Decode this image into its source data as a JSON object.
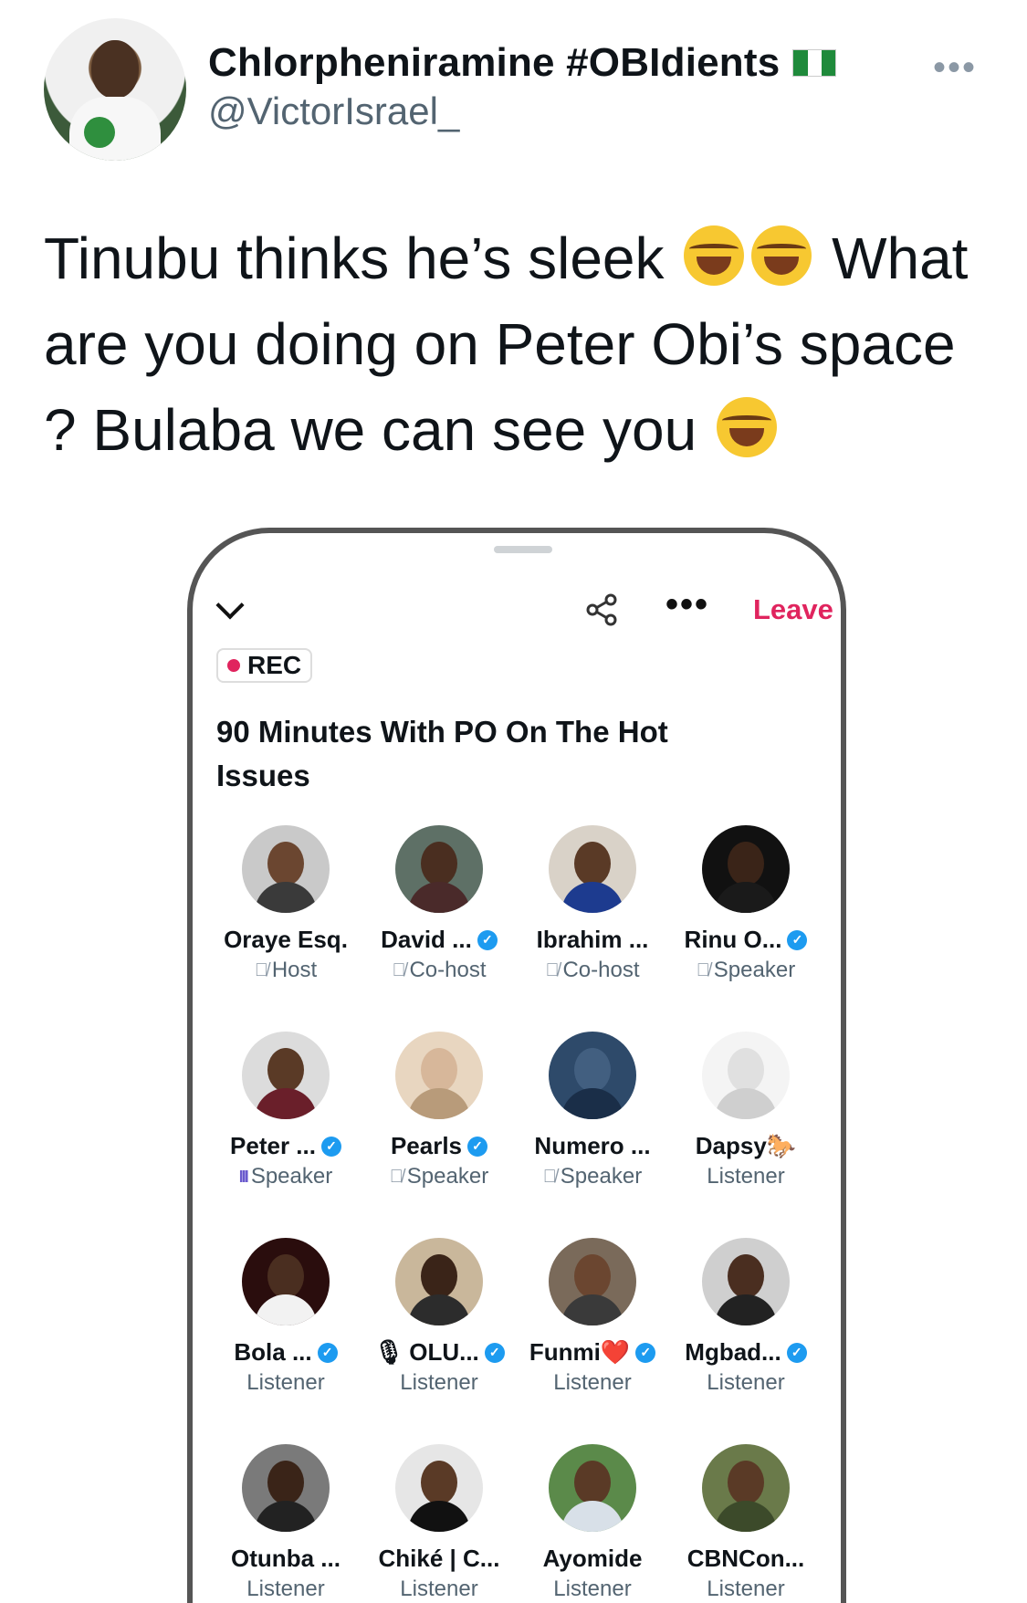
{
  "tweet": {
    "display_name": "Chlorpheniramine #OBIdients",
    "handle": "@VictorIsrael_",
    "more_label": "•••",
    "text_parts": [
      "Tinubu thinks he’s sleek",
      "What are you doing on Peter Obi’s space ? Bulaba we can see you"
    ]
  },
  "space": {
    "leave_label": "Leave",
    "more_label": "•••",
    "rec_label": "REC",
    "title": "90 Minutes With PO On The Hot Issues",
    "people": [
      {
        "name": "Oraye Esq.",
        "role": "Host",
        "mic": "off",
        "verified": false,
        "colors": [
          "#c9c9c9",
          "#6b4630",
          "#3a3a3a"
        ]
      },
      {
        "name": "David ...",
        "role": "Co-host",
        "mic": "off",
        "verified": true,
        "colors": [
          "#5e7066",
          "#4a2e20",
          "#4a2a2a"
        ]
      },
      {
        "name": "Ibrahim ...",
        "role": "Co-host",
        "mic": "off",
        "verified": false,
        "colors": [
          "#d9d2c8",
          "#5a3a26",
          "#1d3b8f"
        ]
      },
      {
        "name": "Rinu O...",
        "role": "Speaker",
        "mic": "off",
        "verified": true,
        "colors": [
          "#111111",
          "#3a2418",
          "#1a1a1a"
        ]
      },
      {
        "name": "Peter ...",
        "role": "Speaker",
        "mic": "on",
        "verified": true,
        "colors": [
          "#dcdcdc",
          "#5a3a26",
          "#6a1f2a"
        ]
      },
      {
        "name": "Pearls",
        "role": "Speaker",
        "mic": "off",
        "verified": true,
        "colors": [
          "#e8d6c0",
          "#d7b79a",
          "#b89b7a"
        ]
      },
      {
        "name": "Numero ...",
        "role": "Speaker",
        "mic": "off",
        "verified": false,
        "colors": [
          "#2e4a6a",
          "#425f80",
          "#1a2e48"
        ]
      },
      {
        "name": "Dapsy🐎",
        "role": "Listener",
        "mic": "none",
        "verified": false,
        "colors": [
          "#f4f4f4",
          "#e0e0e0",
          "#cfcfcf"
        ]
      },
      {
        "name": "Bola ...",
        "role": "Listener",
        "mic": "none",
        "verified": true,
        "colors": [
          "#2a0d0d",
          "#4a2e20",
          "#f2f2f2"
        ]
      },
      {
        "name": "OLU...",
        "role": "Listener",
        "mic": "none",
        "verified": true,
        "prefix": "🎙",
        "colors": [
          "#c9b79b",
          "#3a2418",
          "#2c2c2c"
        ]
      },
      {
        "name": "Funmi❤️",
        "role": "Listener",
        "mic": "none",
        "verified": true,
        "colors": [
          "#7a6a5a",
          "#6b4630",
          "#3a3a3a"
        ]
      },
      {
        "name": "Mgbad...",
        "role": "Listener",
        "mic": "none",
        "verified": true,
        "colors": [
          "#cfcfcf",
          "#4a2e20",
          "#222222"
        ]
      },
      {
        "name": "Otunba ...",
        "role": "Listener",
        "mic": "none",
        "verified": false,
        "colors": [
          "#7a7a7a",
          "#3a2418",
          "#222222"
        ]
      },
      {
        "name": "Chiké | C...",
        "role": "Listener",
        "mic": "none",
        "verified": false,
        "colors": [
          "#e6e6e6",
          "#5a3a26",
          "#111111"
        ]
      },
      {
        "name": "Ayomide",
        "role": "Listener",
        "mic": "none",
        "verified": false,
        "colors": [
          "#5b8a4a",
          "#5a3a26",
          "#d8e0e8"
        ]
      },
      {
        "name": "CBNCon...",
        "role": "Listener",
        "mic": "none",
        "verified": false,
        "colors": [
          "#6a7a4a",
          "#5a3a26",
          "#3c4a2a"
        ]
      }
    ]
  }
}
